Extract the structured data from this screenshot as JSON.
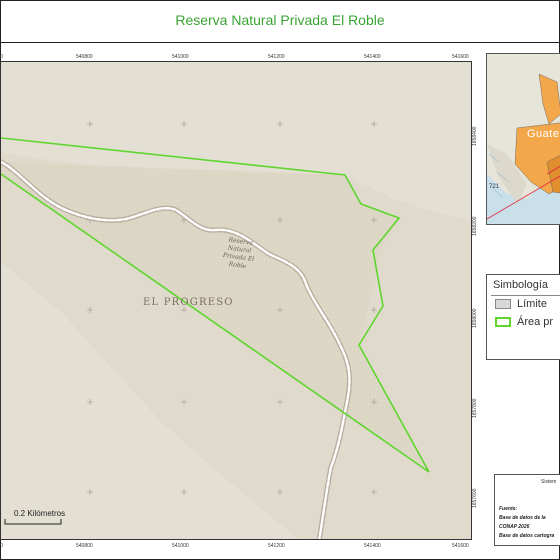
{
  "title": "Reserva Natural Privada El Roble",
  "map": {
    "x_ticks": [
      "540800",
      "541000",
      "541200",
      "541400",
      "541600"
    ],
    "x_ticks_left": "0",
    "y_ticks": [
      "1658400",
      "1658200",
      "1658000",
      "1657800",
      "1657600"
    ],
    "region_label": "EL PROGRESO",
    "road_label_lines": [
      "Reserva",
      "Natural",
      "Privada El",
      "Roble"
    ],
    "scale_label": "0.2 Kilómetros",
    "polygon_color": "#5fd62e",
    "base_color": "#e4dfd3"
  },
  "inset": {
    "label": "Guate",
    "road_number": "721"
  },
  "legend": {
    "title": "Simbología",
    "items": [
      {
        "label": "Límite",
        "color": "#d9d9d9"
      },
      {
        "label": "Área pr",
        "color": "#5fd62e"
      }
    ]
  },
  "info": {
    "system": "Sistem",
    "source_label": "Fuente:",
    "source_lines": [
      "Base de datos de la",
      "CONAP 2026",
      "Base de datos cartogra"
    ]
  }
}
